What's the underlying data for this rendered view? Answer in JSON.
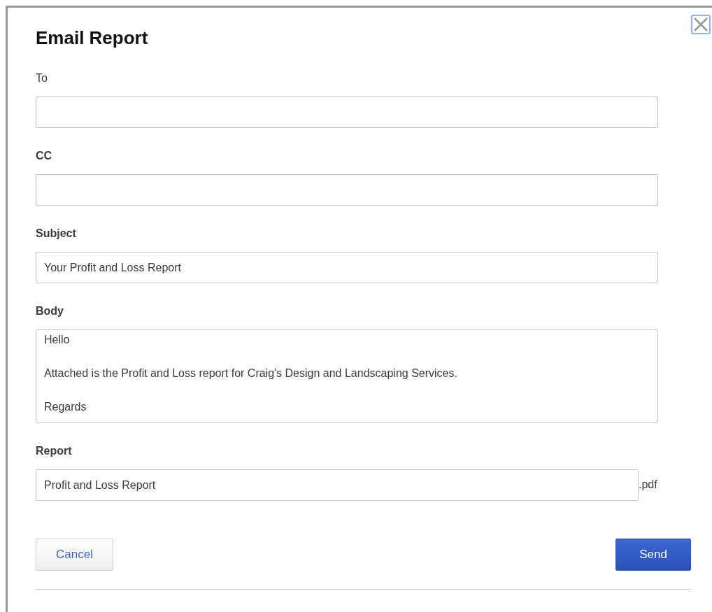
{
  "dialog": {
    "title": "Email Report"
  },
  "fields": [
    {
      "kind": "input",
      "label": "To",
      "label_bold": false
    },
    {
      "kind": "input",
      "label": "CC",
      "label_bold": true
    },
    {
      "kind": "input",
      "label": "Subject",
      "label_bold": true,
      "value": "Your Profit and Loss Report"
    },
    {
      "kind": "textarea",
      "label": "Body",
      "label_bold": true,
      "value": "Hello\n\nAttached is the Profit and Loss report for Craig's Design and Landscaping Services.\n\nRegards"
    },
    {
      "kind": "input",
      "label": "Report",
      "label_bold": true,
      "value": "Profit and Loss Report",
      "suffix": ".pdf"
    }
  ],
  "buttons": [
    {
      "label": "Cancel",
      "kind": "secondary"
    },
    {
      "label": "Send",
      "kind": "primary"
    }
  ]
}
